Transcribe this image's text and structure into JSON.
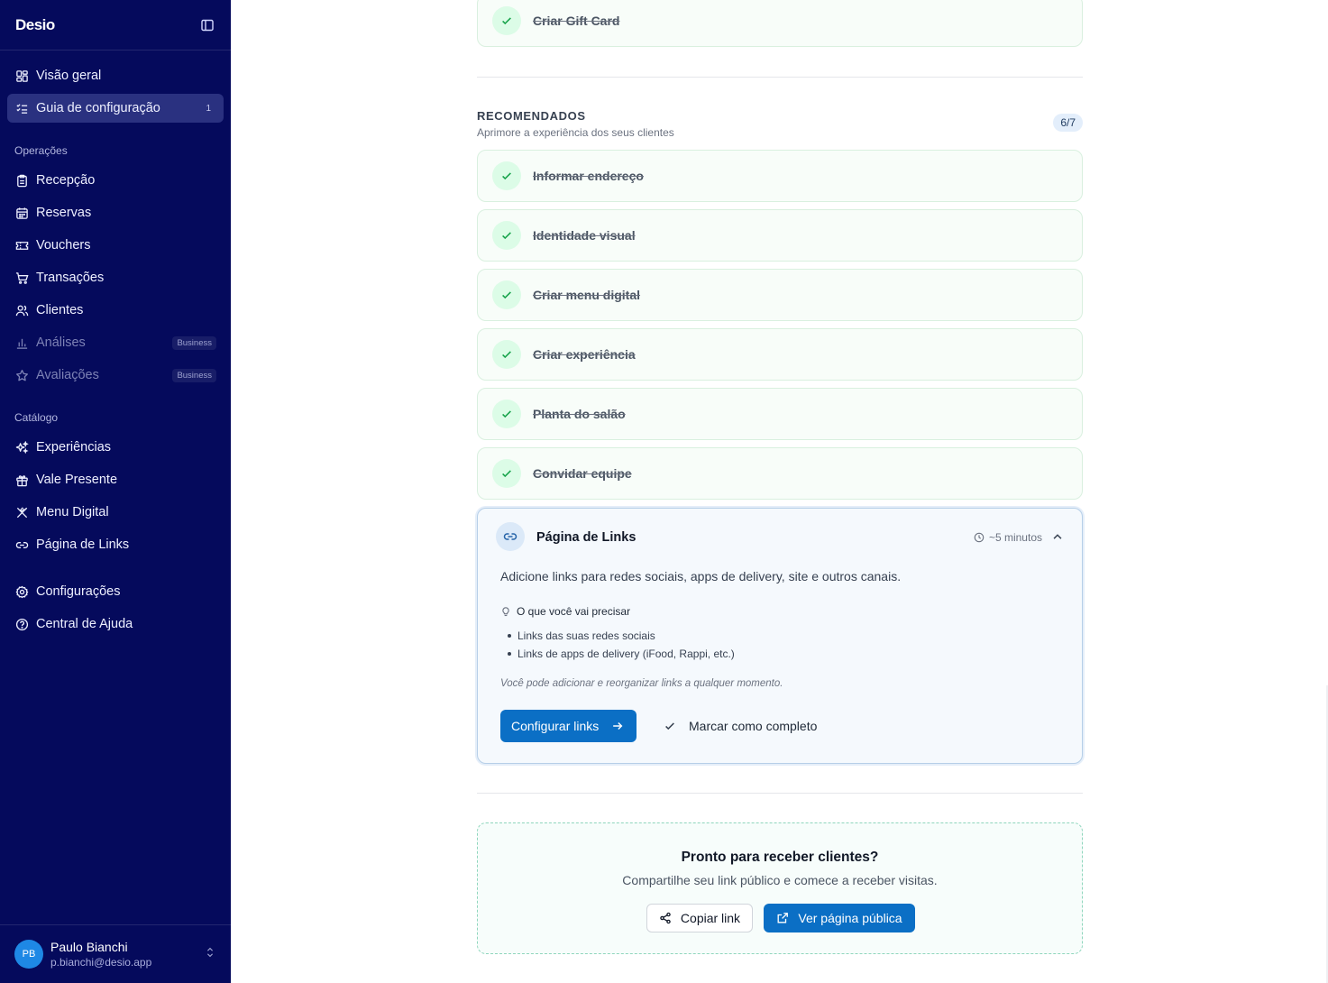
{
  "sidebar": {
    "brand": "Desio",
    "nav_top": [
      {
        "label": "Visão geral",
        "icon": "dashboard-icon"
      },
      {
        "label": "Guia de configuração",
        "icon": "checklist-icon",
        "count": "1",
        "active": true
      }
    ],
    "operations_label": "Operações",
    "operations": [
      {
        "label": "Recepção",
        "icon": "clipboard-icon"
      },
      {
        "label": "Reservas",
        "icon": "calendar-icon"
      },
      {
        "label": "Vouchers",
        "icon": "ticket-icon"
      },
      {
        "label": "Transações",
        "icon": "cart-icon"
      },
      {
        "label": "Clientes",
        "icon": "users-icon"
      },
      {
        "label": "Análises",
        "icon": "chart-icon",
        "badge": "Business",
        "disabled": true
      },
      {
        "label": "Avaliações",
        "icon": "star-icon",
        "badge": "Business",
        "disabled": true
      }
    ],
    "catalog_label": "Catálogo",
    "catalog": [
      {
        "label": "Experiências",
        "icon": "sparkles-icon"
      },
      {
        "label": "Vale Presente",
        "icon": "gift-icon"
      },
      {
        "label": "Menu Digital",
        "icon": "utensils-icon"
      },
      {
        "label": "Página de Links",
        "icon": "link-icon"
      }
    ],
    "bottom": [
      {
        "label": "Configurações",
        "icon": "gear-icon"
      },
      {
        "label": "Central de Ajuda",
        "icon": "help-icon"
      }
    ],
    "user": {
      "initials": "PB",
      "name": "Paulo Bianchi",
      "email": "p.bianchi@desio.app"
    }
  },
  "main": {
    "top_card": "Criar Gift Card",
    "recommended": {
      "title": "RECOMENDADOS",
      "subtitle": "Aprimore a experiência dos seus clientes",
      "count": "6/7",
      "items": [
        "Informar endereço",
        "Identidade visual",
        "Criar menu digital",
        "Criar experiência",
        "Planta do salão",
        "Convidar equipe"
      ]
    },
    "expanded": {
      "title": "Página de Links",
      "time": "~5 minutos",
      "description": "Adicione links para redes sociais, apps de delivery, site e outros canais.",
      "need_title": "O que você vai precisar",
      "needs": [
        "Links das suas redes sociais",
        "Links de apps de delivery (iFood, Rappi, etc.)"
      ],
      "note": "Você pode adicionar e reorganizar links a qualquer momento.",
      "primary_label": "Configurar links",
      "complete_label": "Marcar como completo"
    },
    "cta": {
      "title": "Pronto para receber clientes?",
      "subtitle": "Compartilhe seu link público e comece a receber visitas.",
      "copy_label": "Copiar link",
      "view_label": "Ver página pública"
    }
  },
  "colors": {
    "sidebar_bg": "#050a5c",
    "accent": "#0b6fc5",
    "success": "#16a34a"
  }
}
